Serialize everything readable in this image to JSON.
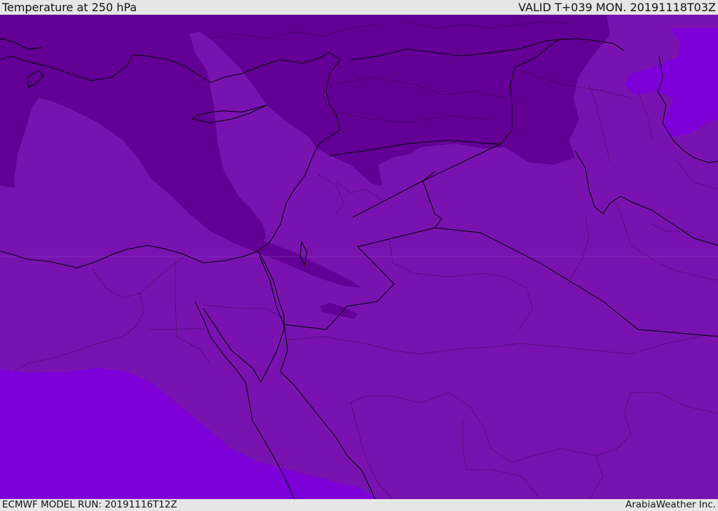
{
  "header": {
    "title": "Temperature at 250 hPa",
    "valid_time": "VALID T+039 MON. 20191118T03Z"
  },
  "footer": {
    "model_run": "ECMWF MODEL RUN: 20191116T12Z",
    "credit": "ArabiaWeather Inc."
  },
  "map": {
    "field": "temperature",
    "level": "250 hPa",
    "colors": {
      "coldest_band": "#620095",
      "middle_band": "#7913b0",
      "warm_band": "#7d00d9",
      "border_line": "#000000"
    }
  }
}
